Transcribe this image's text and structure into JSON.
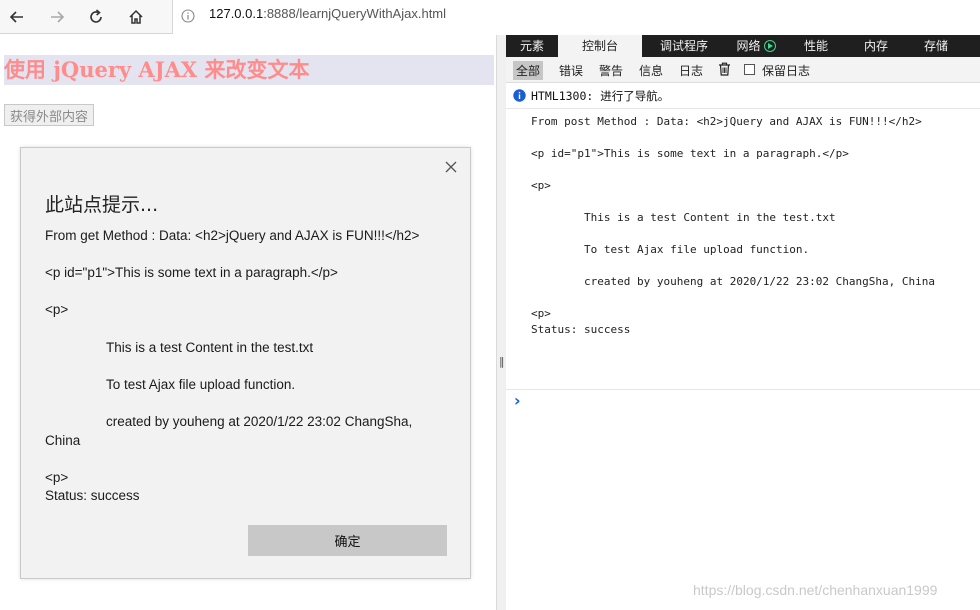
{
  "browser": {
    "url_host": "127.0.0.1",
    "url_path": ":8888/learnjQueryWithAjax.html"
  },
  "page": {
    "heading": "使用 jQuery AJAX 来改变文本",
    "fetch_button": "获得外部内容"
  },
  "dialog": {
    "title": "此站点提示...",
    "lines": [
      "From get Method : Data: <h2>jQuery and AJAX is FUN!!!</h2>",
      "<p id=\"p1\">This is some text in a paragraph.</p>",
      "<p>",
      "This is a test Content in the test.txt",
      "To test Ajax file upload function.",
      "created by youheng at 2020/1/22 23:02 ChangSha,",
      "China",
      "<p>",
      "Status: success"
    ],
    "ok_button": "确定"
  },
  "devtools": {
    "tabs": [
      "元素",
      "控制台",
      "调试程序",
      "网络",
      "性能",
      "内存",
      "存储"
    ],
    "active_tab": "控制台",
    "filters": [
      "全部",
      "错误",
      "警告",
      "信息",
      "日志"
    ],
    "active_filter": "全部",
    "preserve_log": "保留日志",
    "console_message": "HTML1300: 进行了导航。",
    "log_lines": [
      "From post Method : Data: <h2>jQuery and AJAX is FUN!!!</h2>",
      "<p id=\"p1\">This is some text in a paragraph.</p>",
      "<p>",
      "This is a test Content in the test.txt",
      "To test Ajax file upload function.",
      "created by youheng at 2020/1/22 23:02 ChangSha, China",
      "<p>",
      "Status: success"
    ],
    "prompt": "›"
  },
  "watermark": "https://blog.csdn.net/chenhanxuan1999",
  "colors": {
    "heading_text": "#ff8c8c",
    "heading_bg": "#e4e4f0",
    "devtools_tabbar": "#1f1f1f",
    "info_icon": "#1a5fd1",
    "prompt": "#1a5fd1",
    "network_indicator": "#3dd68c"
  },
  "icons": {
    "back": "arrow-left-icon",
    "forward": "arrow-right-icon",
    "refresh": "refresh-icon",
    "home": "home-icon",
    "site_info": "info-circle-icon",
    "close": "close-icon",
    "trash": "trash-icon",
    "console_info": "info-icon"
  }
}
